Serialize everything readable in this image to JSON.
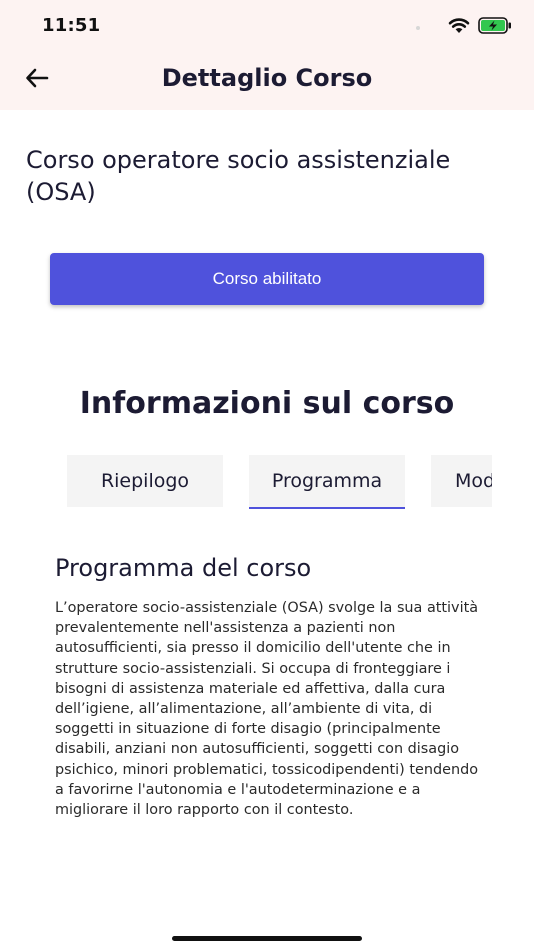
{
  "status_bar": {
    "time": "11:51",
    "icons": [
      "wifi-icon",
      "battery-charging-icon"
    ]
  },
  "header": {
    "title": "Dettaglio Corso",
    "back_icon": "arrow-left-icon"
  },
  "course": {
    "title": "Corso operatore socio assistenziale (OSA)",
    "status_button_label": "Corso abilitato"
  },
  "info_section": {
    "heading": "Informazioni sul corso",
    "tabs": [
      {
        "label": "Riepilogo",
        "active": false
      },
      {
        "label": "Programma",
        "active": true
      },
      {
        "label": "Mod",
        "active": false
      }
    ]
  },
  "program": {
    "heading": "Programma del corso",
    "text": "L’operatore socio-assistenziale (OSA) svolge la sua attività prevalentemente nell'assistenza a pazienti non autosufficienti, sia presso il domicilio dell'utente che in strutture socio-assistenziali. Si occupa di fronteggiare i bisogni di assistenza materiale ed affettiva, dalla cura dell’igiene, all’alimentazione, all’ambiente di vita, di soggetti in situazione di forte disagio (principalmente disabili, anziani non autosufficienti, soggetti con disagio psichico, minori problematici, tossicodipendenti) tendendo a favorirne l'autonomia e l'autodeterminazione e a migliorare il loro rapporto con il contesto."
  },
  "colors": {
    "accent": "#4f52dc",
    "header_bg": "#fdf3f2",
    "tab_bg": "#f4f4f4",
    "text": "#1c1b33",
    "battery": "#32c74f"
  }
}
